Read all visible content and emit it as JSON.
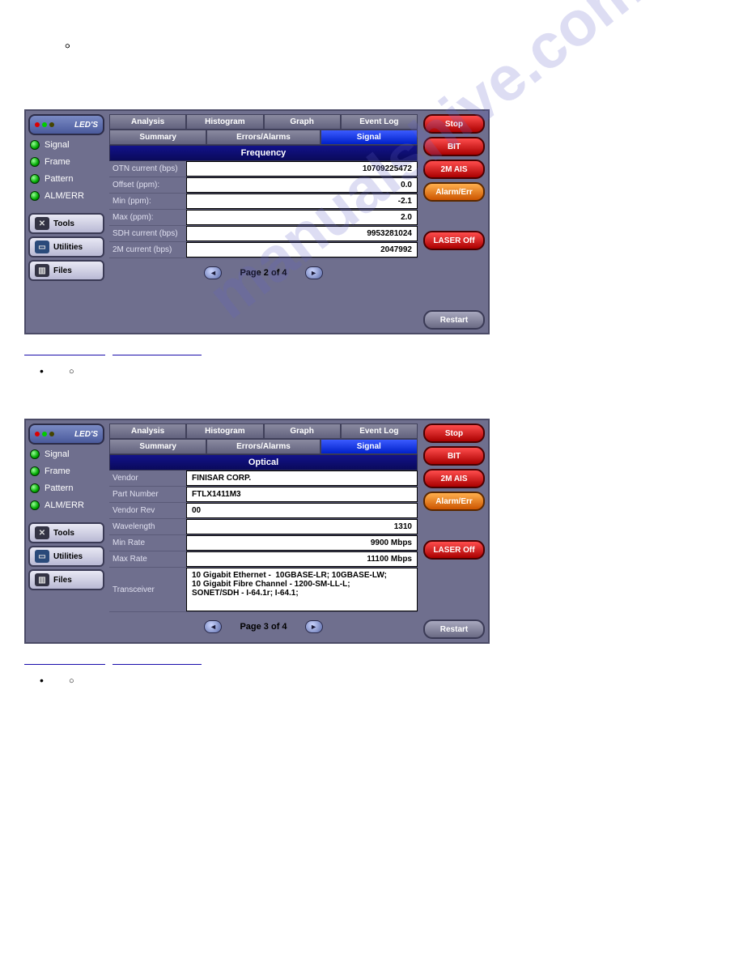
{
  "doc": {
    "top_bullets": [
      "",
      "",
      "",
      "",
      "",
      "",
      ""
    ],
    "linkrow1": {
      "left": "",
      "right": ""
    },
    "section2_bullet": "",
    "section2_sub": "",
    "linkrow2": {
      "left": "",
      "right": ""
    },
    "section3_bullet": "",
    "section3_sub": ""
  },
  "watermark": "manualshive.com",
  "panel_shared": {
    "leds_label": "LED'S",
    "led_items": [
      "Signal",
      "Frame",
      "Pattern",
      "ALM/ERR"
    ],
    "side_buttons": [
      "Tools",
      "Utilities",
      "Files"
    ],
    "tabrow1": [
      "Analysis",
      "Histogram",
      "Graph",
      "Event Log"
    ],
    "tabrow2": [
      "Summary",
      "Errors/Alarms",
      "Signal"
    ],
    "right_buttons": [
      "Stop",
      "BIT",
      "2M AIS",
      "Alarm/Err",
      "LASER Off",
      "Restart"
    ]
  },
  "panel1": {
    "section_title": "Frequency",
    "rows": [
      {
        "label": "OTN current (bps)",
        "value": "10709225472"
      },
      {
        "label": "Offset (ppm):",
        "value": "0.0"
      },
      {
        "label": "Min (ppm):",
        "value": "-2.1"
      },
      {
        "label": "Max (ppm):",
        "value": "2.0"
      },
      {
        "label": "SDH current (bps)",
        "value": "9953281024"
      },
      {
        "label": "2M current (bps)",
        "value": "2047992"
      }
    ],
    "pager": "Page 2 of 4"
  },
  "panel2": {
    "section_title": "Optical",
    "rows": [
      {
        "label": "Vendor",
        "value": "FINISAR CORP.",
        "align": "left"
      },
      {
        "label": "Part Number",
        "value": "FTLX1411M3",
        "align": "left"
      },
      {
        "label": "Vendor Rev",
        "value": "00",
        "align": "left"
      },
      {
        "label": "Wavelength",
        "value": "1310"
      },
      {
        "label": "Min Rate",
        "value": "9900 Mbps"
      },
      {
        "label": "Max Rate",
        "value": "11100 Mbps"
      },
      {
        "label": "Transceiver",
        "value": "10 Gigabit Ethernet -  10GBASE-LR; 10GBASE-LW;\n10 Gigabit Fibre Channel - 1200-SM-LL-L;\nSONET/SDH - I-64.1r; I-64.1;",
        "tall": true
      }
    ],
    "pager": "Page 3 of 4"
  }
}
